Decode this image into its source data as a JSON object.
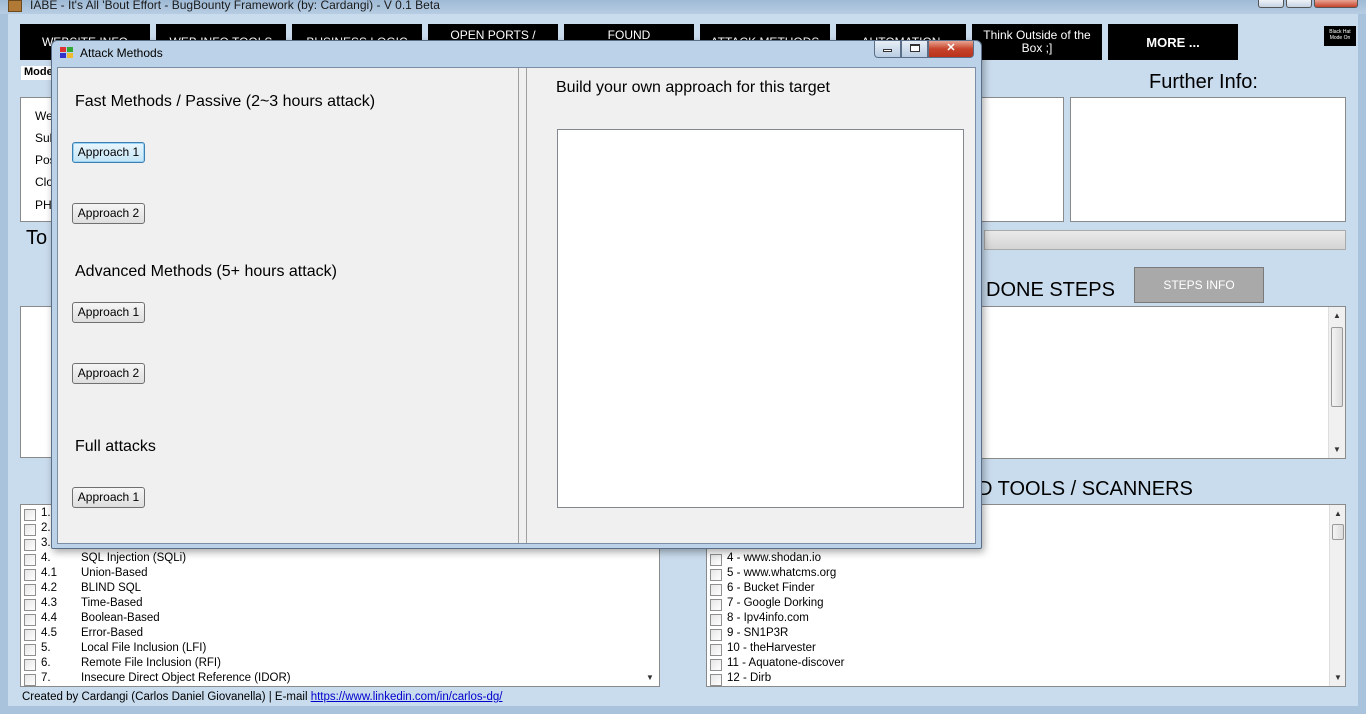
{
  "main_window": {
    "title": "IABE - It's All 'Bout Effort - BugBounty Framework (by: Cardangi) - V 0.1 Beta"
  },
  "nav": {
    "buttons": [
      "WEBSITE INFO",
      "WEB INFO TOOLS",
      "BUSINESS LOGIC",
      "OPEN PORTS / SERVICES",
      "FOUND VULNERABILITIES",
      "ATTACK METHODS",
      "AUTOMATION",
      "Think Outside of the Box ;]",
      "MORE ..."
    ],
    "black_hat": "Black Hat Mode On"
  },
  "left_panel": {
    "mode_label": "Mode",
    "info_rows": [
      "We",
      "Sub",
      "Pos",
      "Clo",
      "PH"
    ],
    "tools_heading": "To"
  },
  "right_panel": {
    "further_info": "Further Info:",
    "done_steps": "DONE STEPS",
    "steps_info_button": "STEPS INFO",
    "tools_scanners": "D TOOLS / SCANNERS"
  },
  "vuln_list": [
    {
      "num": "1.",
      "name": ""
    },
    {
      "num": "2.",
      "name": ""
    },
    {
      "num": "3.",
      "name": ""
    },
    {
      "num": "4.",
      "name": "SQL Injection (SQLi)"
    },
    {
      "num": "4.1",
      "name": "Union-Based"
    },
    {
      "num": "4.2",
      "name": "BLIND SQL"
    },
    {
      "num": "4.3",
      "name": "Time-Based"
    },
    {
      "num": "4.4",
      "name": "Boolean-Based"
    },
    {
      "num": "4.5",
      "name": "Error-Based"
    },
    {
      "num": "5.",
      "name": "Local File Inclusion (LFI)"
    },
    {
      "num": "6.",
      "name": "Remote File Inclusion (RFI)"
    },
    {
      "num": "7.",
      "name": "Insecure Direct Object Reference (IDOR)"
    }
  ],
  "tools_list": [
    "4 - www.shodan.io",
    "5 - www.whatcms.org",
    "6 - Bucket Finder",
    "7 - Google Dorking",
    "8 - Ipv4info.com",
    "9 - SN1P3R",
    "10 - theHarvester",
    "11 - Aquatone-discover",
    "12 - Dirb"
  ],
  "footer": {
    "text": "Created by Cardangi (Carlos Daniel Giovanella) | E-mail ",
    "link": "https://www.linkedin.com/in/carlos-dg/"
  },
  "dialog": {
    "title": "Attack Methods",
    "close_glyph": "✕",
    "fast_heading": "Fast Methods / Passive (2~3 hours attack)",
    "fast_buttons": [
      "Approach 1",
      "Approach 2"
    ],
    "advanced_heading": "Advanced Methods (5+ hours attack)",
    "advanced_buttons": [
      "Approach 1",
      "Approach 2"
    ],
    "full_heading": "Full attacks",
    "full_buttons": [
      "Approach 1"
    ],
    "build_heading": "Build your own approach for this target"
  }
}
